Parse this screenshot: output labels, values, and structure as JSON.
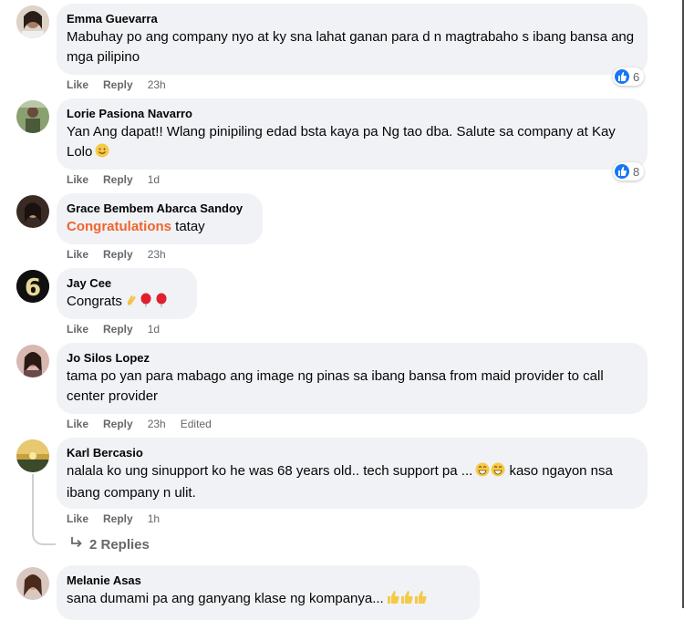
{
  "comments": [
    {
      "author": "Emma Guevarra",
      "text": "Mabuhay po ang company nyo at ky sna lahat ganan para d n magtrabaho s ibang bansa ang mga pilipino",
      "like": "Like",
      "reply": "Reply",
      "time": "23h",
      "reactions": "6"
    },
    {
      "author": "Lorie Pasiona Navarro",
      "text": "Yan Ang dapat!! Wlang pinipiling edad bsta kaya pa Ng tao dba. Salute sa company at Kay Lolo",
      "like": "Like",
      "reply": "Reply",
      "time": "1d",
      "reactions": "8"
    },
    {
      "author": "Grace Bembem Abarca Sandoy",
      "highlight": "Congratulations",
      "text": " tatay",
      "like": "Like",
      "reply": "Reply",
      "time": "23h"
    },
    {
      "author": "Jay Cee",
      "text": "Congrats",
      "like": "Like",
      "reply": "Reply",
      "time": "1d"
    },
    {
      "author": "Jo Silos Lopez",
      "text": "tama po yan para mabago ang image ng pinas sa ibang bansa from maid provider to call center provider",
      "like": "Like",
      "reply": "Reply",
      "time": "23h",
      "edited": "Edited"
    },
    {
      "author": "Karl Bercasio",
      "text": "nalala ko ung sinupport ko he was 68 years old.. tech support pa ...",
      "text2": "kaso ngayon nsa ibang company n ulit.",
      "like": "Like",
      "reply": "Reply",
      "time": "1h",
      "replies": "2 Replies"
    },
    {
      "author": "Melanie Asas",
      "text": "sana dumami pa ang ganyang klase ng kompanya..."
    }
  ],
  "colors": {
    "bubble": "#f0f2f5",
    "highlight": "#f0642d",
    "like_blue": "#1877f2",
    "meta": "#65676b"
  }
}
